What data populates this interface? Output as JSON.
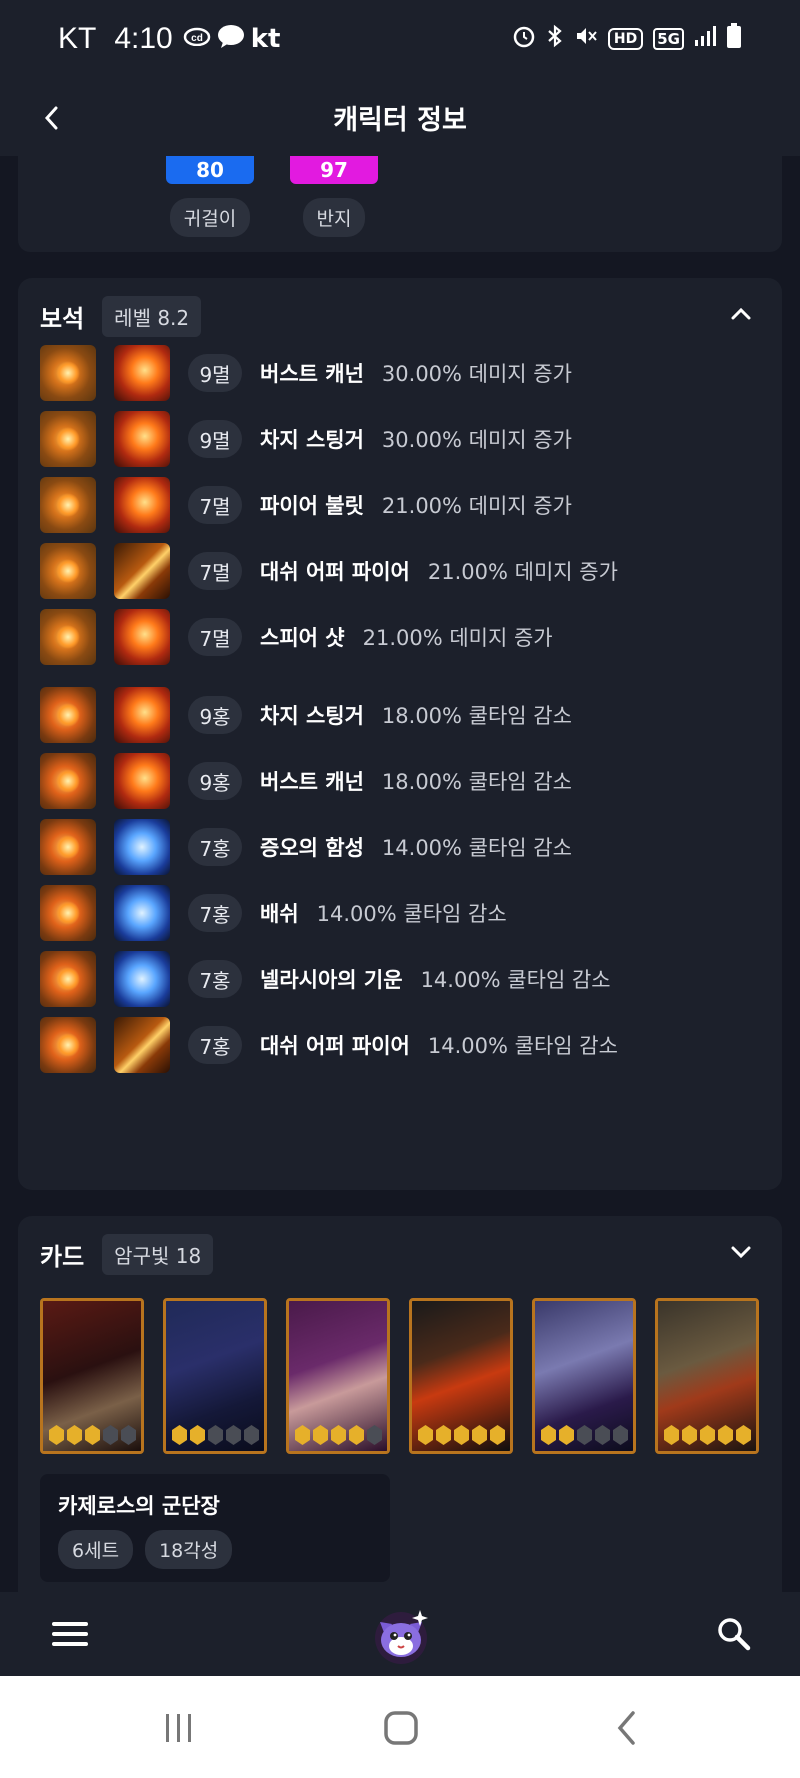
{
  "status_bar": {
    "carrier": "KT",
    "time": "4:10",
    "left_icons": [
      "cloud-icon",
      "talk-bubble-icon",
      "kt-icon"
    ],
    "kt_label": "kt",
    "right_icons": [
      "alarm-icon",
      "bluetooth-icon",
      "mute-icon",
      "hd-icon",
      "5g-icon",
      "signal-icon",
      "battery-icon"
    ],
    "hd_label": "HD",
    "fiveg_label": "5G"
  },
  "header": {
    "title": "캐릭터 정보",
    "back_icon": "chevron-left-icon"
  },
  "accessories": [
    {
      "value": "80",
      "label": "귀걸이",
      "color": "#1a6bf0"
    },
    {
      "value": "97",
      "label": "반지",
      "color": "#e21ae0"
    }
  ],
  "gems": {
    "title": "보석",
    "level_chip": "레벨 8.2",
    "expanded": true,
    "items": [
      {
        "level": "9멸",
        "skill": "버스트 캐넌",
        "effect": "30.00% 데미지 증가",
        "skill_icon": "fire"
      },
      {
        "level": "9멸",
        "skill": "차지 스팅거",
        "effect": "30.00% 데미지 증가",
        "skill_icon": "fire"
      },
      {
        "level": "7멸",
        "skill": "파이어 불릿",
        "effect": "21.00% 데미지 증가",
        "skill_icon": "fire"
      },
      {
        "level": "7멸",
        "skill": "대쉬 어퍼 파이어",
        "effect": "21.00% 데미지 증가",
        "skill_icon": "arrow"
      },
      {
        "level": "7멸",
        "skill": "스피어 샷",
        "effect": "21.00% 데미지 증가",
        "skill_icon": "fire"
      },
      {
        "level": "9홍",
        "skill": "차지 스팅거",
        "effect": "18.00% 쿨타임 감소",
        "skill_icon": "fire"
      },
      {
        "level": "9홍",
        "skill": "버스트 캐넌",
        "effect": "18.00% 쿨타임 감소",
        "skill_icon": "fire"
      },
      {
        "level": "7홍",
        "skill": "증오의 함성",
        "effect": "14.00% 쿨타임 감소",
        "skill_icon": "ice"
      },
      {
        "level": "7홍",
        "skill": "배쉬",
        "effect": "14.00% 쿨타임 감소",
        "skill_icon": "ice"
      },
      {
        "level": "7홍",
        "skill": "넬라시아의 기운",
        "effect": "14.00% 쿨타임 감소",
        "skill_icon": "ice"
      },
      {
        "level": "7홍",
        "skill": "대쉬 어퍼 파이어",
        "effect": "14.00% 쿨타임 감소",
        "skill_icon": "arrow"
      }
    ]
  },
  "cards": {
    "title": "카드",
    "chip": "암구빛 18",
    "expanded": false,
    "items": [
      {
        "awakening": 3,
        "art": "dark-red"
      },
      {
        "awakening": 2,
        "art": "dark-blue"
      },
      {
        "awakening": 4,
        "art": "purple"
      },
      {
        "awakening": 5,
        "art": "fire-dark"
      },
      {
        "awakening": 2,
        "art": "violet"
      },
      {
        "awakening": 5,
        "art": "bone-gold"
      }
    ],
    "set": {
      "name": "카제로스의 군단장",
      "count": "6세트",
      "awakening": "18각성"
    }
  },
  "bottom_nav": {
    "menu_icon": "hamburger-menu-icon",
    "mascot_icon": "mascot-cat-icon",
    "search_icon": "search-icon"
  },
  "system_nav": {
    "recents_icon": "recents-icon",
    "home_icon": "home-icon",
    "back_icon": "back-icon"
  }
}
